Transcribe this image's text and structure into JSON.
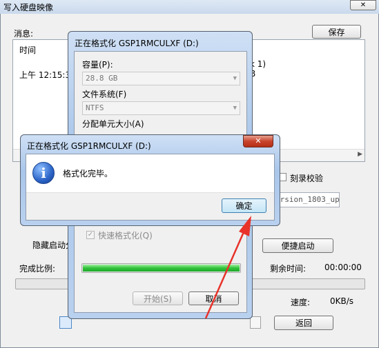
{
  "main_window": {
    "title": "写入硬盘映像",
    "messages_label": "消息:",
    "save_button": "保存",
    "time_column": "时间",
    "log_time": "上午 12:15:3",
    "log_frag_1": "k 1)",
    "log_frag_2": "B",
    "verify_label": "刻录校验",
    "version_field": "ersion_1803_up",
    "hidden_boot_label": "隐藏启动分",
    "quick_boot_button": "便捷启动",
    "progress_label": "完成比例:",
    "remaining_label": "剩余时间:",
    "remaining_value": "00:00:00",
    "speed_label": "速度:",
    "speed_value": "0KB/s",
    "back_button": "返回",
    "close_glyph": "✕"
  },
  "format_dialog": {
    "title": "正在格式化 GSP1RMCULXF (D:)",
    "capacity_label": "容量(P):",
    "capacity_value": "28.8 GB",
    "filesystem_label": "文件系统(F)",
    "filesystem_value": "NTFS",
    "alloc_label": "分配单元大小(A)",
    "quick_format_label": "快速格式化(Q)",
    "progress_percent": 100,
    "start_button": "开始(S)",
    "cancel_button": "取消"
  },
  "message_box": {
    "title": "正在格式化 GSP1RMCULXF (D:)",
    "message": "格式化完毕。",
    "ok_button": "确定",
    "close_glyph": "✕",
    "info_glyph": "i"
  },
  "colors": {
    "accent_blue": "#2b63c7",
    "progress_green": "#31c23a",
    "annotation_red": "#e8322a"
  }
}
